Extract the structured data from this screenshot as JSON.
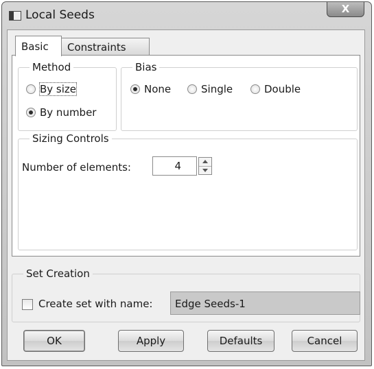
{
  "window": {
    "title": "Local Seeds",
    "close_glyph": "X"
  },
  "tabs": [
    {
      "label": "Basic",
      "active": true
    },
    {
      "label": "Constraints",
      "active": false
    }
  ],
  "method": {
    "legend": "Method",
    "options": [
      {
        "label": "By size",
        "selected": false
      },
      {
        "label": "By number",
        "selected": true
      }
    ]
  },
  "bias": {
    "legend": "Bias",
    "options": [
      {
        "label": "None",
        "selected": true
      },
      {
        "label": "Single",
        "selected": false
      },
      {
        "label": "Double",
        "selected": false
      }
    ]
  },
  "sizing": {
    "legend": "Sizing Controls",
    "number_label": "Number of elements:",
    "number_value": "4"
  },
  "set_creation": {
    "legend": "Set Creation",
    "checkbox_label": "Create set with name:",
    "checked": false,
    "set_name": "Edge Seeds-1"
  },
  "buttons": {
    "ok": "OK",
    "apply": "Apply",
    "defaults": "Defaults",
    "cancel": "Cancel"
  },
  "icons": {
    "app": "window-icon",
    "close": "close-icon",
    "spin_up": "chevron-up-icon",
    "spin_down": "chevron-down-icon"
  }
}
